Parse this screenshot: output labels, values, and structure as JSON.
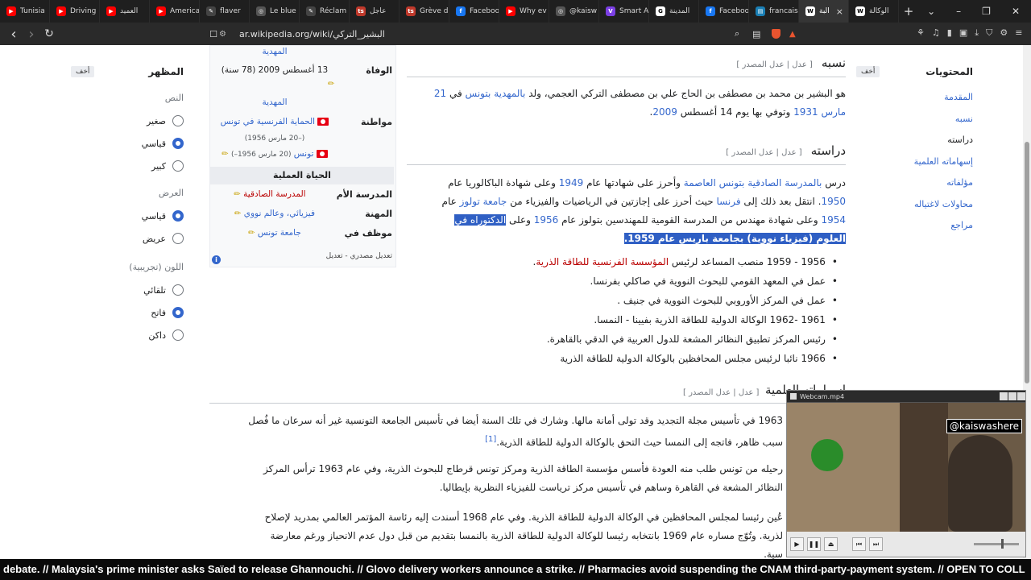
{
  "tabs": [
    {
      "label": "Tunisia",
      "color": "#ff0000",
      "glyph": "▶"
    },
    {
      "label": "Driving",
      "color": "#ff0000",
      "glyph": "▶"
    },
    {
      "label": "العميد",
      "color": "#ff0000",
      "glyph": "▶"
    },
    {
      "label": "America",
      "color": "#ff0000",
      "glyph": "▶"
    },
    {
      "label": "flaver",
      "color": "#444444",
      "glyph": "✎"
    },
    {
      "label": "Le blue",
      "color": "#555555",
      "glyph": "◎"
    },
    {
      "label": "Réclam",
      "color": "#444444",
      "glyph": "✎"
    },
    {
      "label": "عاجل",
      "color": "#c0392b",
      "glyph": "ts"
    },
    {
      "label": "Grève d",
      "color": "#c0392b",
      "glyph": "ts"
    },
    {
      "label": "Faceboo",
      "color": "#1877f2",
      "glyph": "f"
    },
    {
      "label": "Why ev",
      "color": "#ff0000",
      "glyph": "▶"
    },
    {
      "label": "@kaisw",
      "color": "#555555",
      "glyph": "◎"
    },
    {
      "label": "Smart A",
      "color": "#7b3fe4",
      "glyph": "V"
    },
    {
      "label": "المدينة",
      "color": "#ffffff",
      "glyph": "G"
    },
    {
      "label": "Faceboo",
      "color": "#1877f2",
      "glyph": "f"
    },
    {
      "label": "francais",
      "color": "#1a7fb5",
      "glyph": "▤"
    },
    {
      "label": "البة",
      "color": "#ffffff",
      "glyph": "W",
      "active": true
    },
    {
      "label": "الوكالة",
      "color": "#ffffff",
      "glyph": "W"
    }
  ],
  "toolbar": {
    "url": "ar.wikipedia.org/wiki/البشير_التركي",
    "back": "‹",
    "forward": "›",
    "reload": "↻",
    "bookmark": "☐"
  },
  "toc": {
    "title": "المحتويات",
    "hide": "أخف",
    "items": [
      "المقدمة",
      "نسبه",
      "دراسته",
      "إسهاماته العلمية",
      "مؤلفاته",
      "محاولات لاغتياله",
      "مراجع"
    ]
  },
  "appearance": {
    "title": "المظهر",
    "hide": "أخف",
    "text_label": "النص",
    "text_opts": [
      {
        "label": "صغير",
        "on": false
      },
      {
        "label": "قياسي",
        "on": true
      },
      {
        "label": "كبير",
        "on": false
      }
    ],
    "width_label": "العرض",
    "width_opts": [
      {
        "label": "قياسي",
        "on": true
      },
      {
        "label": "عريض",
        "on": false
      }
    ],
    "color_label": "اللون (تجريبية)",
    "color_opts": [
      {
        "label": "تلقائي",
        "on": false
      },
      {
        "label": "فاتح",
        "on": true
      },
      {
        "label": "داكن",
        "on": false
      }
    ]
  },
  "infobox": {
    "top_link": "المهدية",
    "death_label": "الوفاة",
    "death_value": "13 أغسطس 2009 (78 سنة)",
    "death_place": "المهدية",
    "citizenship_label": "مواطنة",
    "cit1": "الحماية الفرنسية في تونس",
    "cit1_dates": "(–20 مارس 1956)",
    "cit2": "تونس",
    "cit2_dates": "(20 مارس 1956–)",
    "career_header": "الحياة العملية",
    "alma_label": "المدرسة الأم",
    "alma_value": "المدرسة الصادقية",
    "job_label": "المهنة",
    "job_value": "فيزيائي، وعالم نووي",
    "employer_label": "موظف في",
    "employer_value": "جامعة تونس",
    "footer": "تعديل مصدري - تعديل"
  },
  "article": {
    "s1_title": "نسبه",
    "s1_edit": "[ عدل | عدل المصدر ]",
    "s1_text_a": "هو البشير بن محمد بن مصطفى بن الحاج علي بن مصطفى التركي العجمي، ولد ",
    "s1_link1": "بالمهدية",
    "s1_link2": "بتونس",
    "s1_text_b": " في ",
    "s1_link3": "21 مارس",
    "s1_link4": "1931",
    "s1_text_c": " وتوفي بها يوم 14 أغسطس ",
    "s1_link5": "2009",
    "s2_title": "دراسته",
    "s2_edit": "[ عدل | عدل المصدر ]",
    "s2_line1_a": "درس ",
    "s2_line1_link": "بالمدرسة الصادقية بتونس العاصمة",
    "s2_line1_b": " وأحرز على شهادتها عام ",
    "s2_line1_y": "1949",
    "s2_line1_c": " وعلى شهادة الباكالوريا عام",
    "s2_line2_y": "1950",
    "s2_line2_a": ". انتقل بعد ذلك إلى ",
    "s2_line2_l": "فرنسا",
    "s2_line2_b": " حيث أحرز على إجازتين في الرياضيات والفيزياء من ",
    "s2_line2_l2": "جامعة تولوز",
    "s2_line2_c": " عام",
    "s2_line3_y": "1954",
    "s2_line3_a": " وعلى شهادة مهندس من المدرسة القومية للمهندسين بتولوز عام ",
    "s2_line3_y2": "1956",
    "s2_line3_b": " وعلى ",
    "s2_line3_hl": "الدكتوراه في",
    "s2_line4_hl": "العلوم (فيزياء نووية) بجامعة باريس عام 1959.",
    "list": [
      {
        "text": "1956 - 1959 منصب المساعد لرئيس ",
        "link": "المؤسسة الفرنسية للطاقة الذرية",
        "end": "."
      },
      {
        "text": "عمل في المعهد القومي للبحوث النووية في صاكلي بفرنسا.",
        "link": "",
        "end": ""
      },
      {
        "text": "عمل في المركز الأوروبي للبحوث النووية في جنيف .",
        "link": "",
        "end": ""
      },
      {
        "text": "1961 -1962 الوكالة الدولية للطاقة الذرية بفيينا - النمسا.",
        "link": "",
        "end": ""
      },
      {
        "text": "رئيس المركز تطبيق النظائر المشعة للدول العربية في الدقي بالقاهرة.",
        "link": "",
        "end": ""
      },
      {
        "text": "1966 نائبا لرئيس مجلس المحافظين بالوكالة الدولية للطاقة الذرية",
        "link": "",
        "end": ""
      }
    ],
    "s3_title": "إسهاماته العلمية",
    "s3_edit": "[ عدل | عدل المصدر ]",
    "s3_p1_l1": "1963 في تأسيس مجلة التجديد وقد تولى أمانة مالها. وشارك في تلك السنة أيضا في تأسيس الجامعة التونسية غير أنه سرعان ما فُصل",
    "s3_p1_l2": "سبب ظاهر، فاتجه إلى النمسا حيث التحق بالوكالة الدولية للطاقة الذرية.",
    "s3_p1_ref": "[1]",
    "s3_p2_l1": "رحيله من تونس طلب منه العودة فأسس مؤسسة الطاقة الذرية ومركز تونس قرطاج للبحوث الذرية، وفي عام 1963 ترأس المركز",
    "s3_p2_l2": "النظائر المشعة في القاهرة وساهم في تأسيس مركز ترياست للفيزياء النظرية بإيطاليا.",
    "s3_p3_l1": "عُين رئيسا لمجلس المحافظين في الوكالة الدولية للطاقة الذرية. وفي عام 1968 أسندت إليه رئاسة المؤتمر العالمي بمدريد لإصلاح",
    "s3_p3_l2": "لذرية. وتُوّج مساره عام 1969 بانتخابه رئيسا للوكالة الدولية للطاقة الذرية بالنمسا بتقديم من قبل دول عدم الانحياز ورغم معارضة",
    "s3_p3_l3": "سية."
  },
  "webcam": {
    "title": "Webcam.mp4",
    "tag": "@kaiswashere"
  },
  "ticker": "debate. // Malaysia's prime minister asks Saïed to release Ghannouchi. // Glovo delivery workers announce a strike. // Pharmacies avoid suspending the CNAM third-party-payment system. // OPEN TO COLL"
}
